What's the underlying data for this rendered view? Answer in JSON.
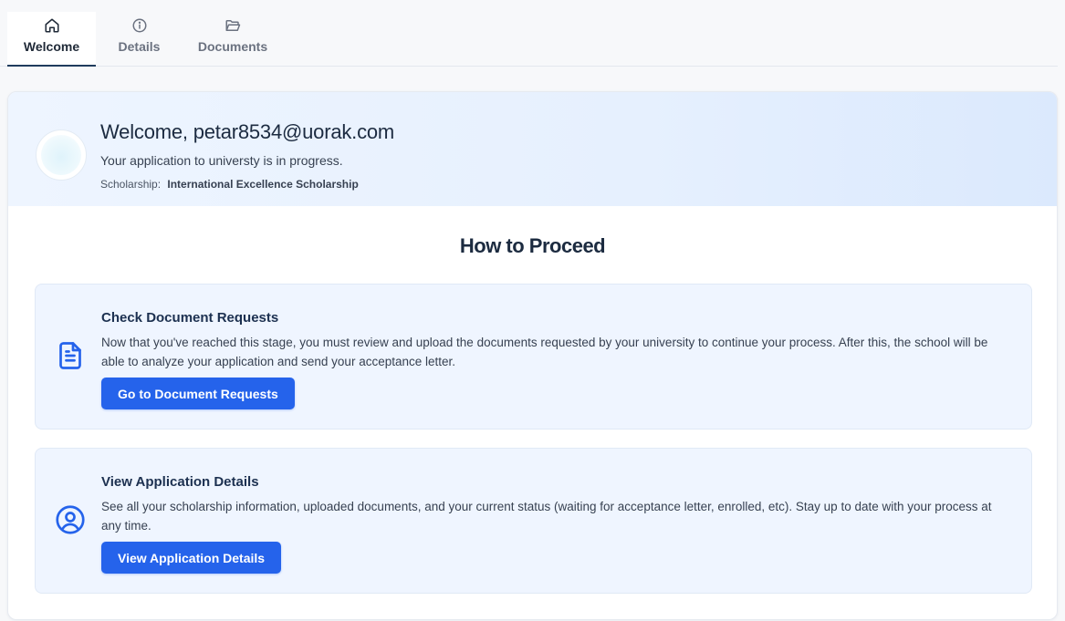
{
  "tabs": [
    {
      "label": "Welcome",
      "icon": "home-icon",
      "active": true
    },
    {
      "label": "Details",
      "icon": "info-icon",
      "active": false
    },
    {
      "label": "Documents",
      "icon": "folder-open-icon",
      "active": false
    }
  ],
  "header": {
    "welcome": "Welcome, petar8534@uorak.com",
    "progress": "Your application to universty is in progress.",
    "scholarship_label": "Scholarship:",
    "scholarship_value": "International Excellence Scholarship"
  },
  "section_title": "How to Proceed",
  "steps": [
    {
      "title": "Check Document Requests",
      "description": "Now that you've reached this stage, you must review and upload the documents requested by your university to continue your process. After this, the school will be able to analyze your application and send your acceptance letter.",
      "button": "Go to Document Requests",
      "icon": "document-icon"
    },
    {
      "title": "View Application Details",
      "description": "See all your scholarship information, uploaded documents, and your current status (waiting for acceptance letter, enrolled, etc). Stay up to date with your process at any time.",
      "button": "View Application Details",
      "icon": "user-circle-icon"
    }
  ],
  "colors": {
    "accent": "#2563eb",
    "title": "#1c2b40",
    "step_bg": "#eff5ff"
  }
}
